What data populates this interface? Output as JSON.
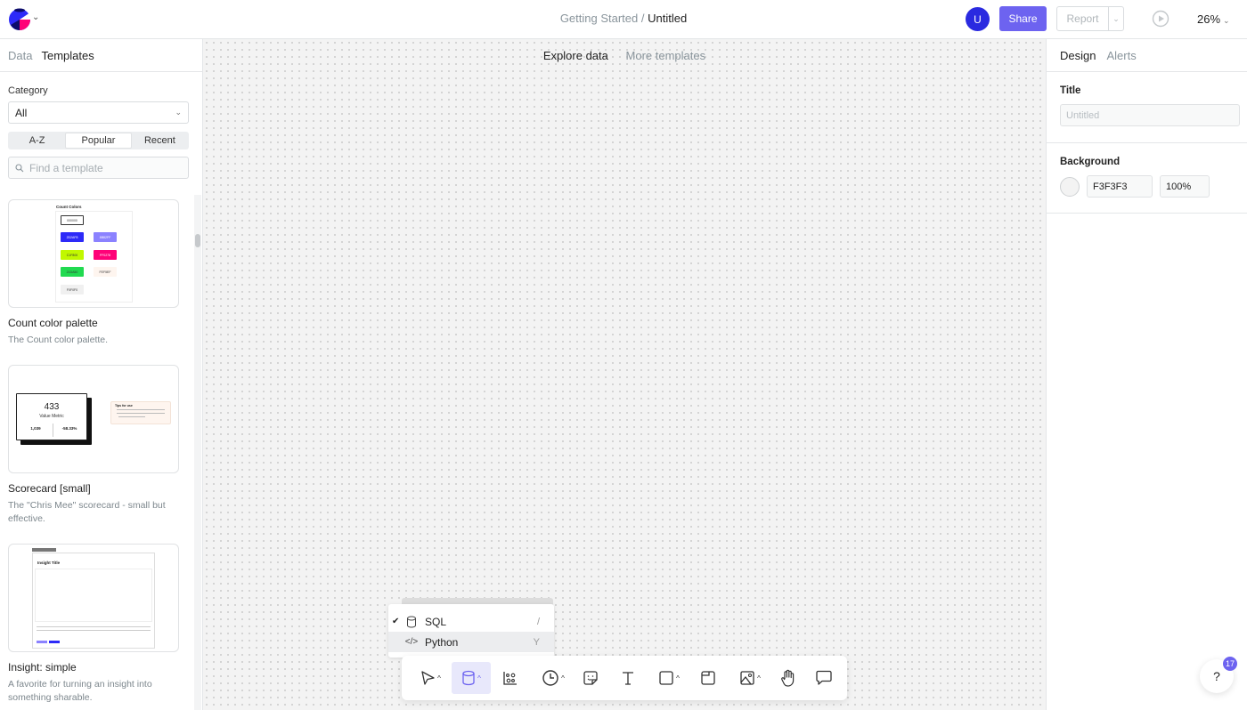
{
  "header": {
    "breadcrumb_parent": "Getting Started",
    "breadcrumb_sep": " / ",
    "breadcrumb_current": "Untitled",
    "avatar_initial": "U",
    "share_label": "Share",
    "report_label": "Report",
    "zoom_level": "26%"
  },
  "left_panel": {
    "tabs": [
      {
        "label": "Data",
        "active": false
      },
      {
        "label": "Templates",
        "active": true
      }
    ],
    "category_label": "Category",
    "category_value": "All",
    "sort_options": [
      {
        "label": "A-Z",
        "active": false
      },
      {
        "label": "Popular",
        "active": true
      },
      {
        "label": "Recent",
        "active": false
      }
    ],
    "search_placeholder": "Find a template",
    "templates": [
      {
        "title": "Count color palette",
        "description": "The Count color palette.",
        "preview": {
          "heading": "Count Colors",
          "swatches": [
            {
              "label": "000000",
              "color": "#ffffff",
              "text": "#333333"
            },
            {
              "label": "2D2AF8",
              "color": "#2d2af8",
              "text": "#ffffff"
            },
            {
              "label": "8B82FF",
              "color": "#8b82ff",
              "text": "#ffffff"
            },
            {
              "label": "C1F800",
              "color": "#c1f800",
              "text": "#333333"
            },
            {
              "label": "FF0278",
              "color": "#ff0278",
              "text": "#ffffff"
            },
            {
              "label": "21DA50",
              "color": "#21da50",
              "text": "#333333"
            },
            {
              "label": "FEF5EF",
              "color": "#fef5ef",
              "text": "#333333"
            },
            {
              "label": "F0F0F0",
              "color": "#f0f0f0",
              "text": "#333333"
            }
          ]
        }
      },
      {
        "title": "Scorecard [small]",
        "description": "The \"Chris Mee\" scorecard - small but effective.",
        "preview": {
          "value": "433",
          "metric": "Value Metric",
          "left_value": "1,039",
          "right_value": "-58.33%",
          "tips_title": "Tips for use"
        }
      },
      {
        "title": "Insight: simple",
        "description": "A favorite for turning an insight into something sharable.",
        "preview": {
          "heading": "Insight Title"
        }
      }
    ]
  },
  "canvas": {
    "tabs": [
      {
        "label": "Explore data",
        "active": true
      },
      {
        "label": "More templates",
        "active": false
      }
    ],
    "background": "#f3f3f3"
  },
  "cell_type_menu": {
    "items": [
      {
        "label": "SQL",
        "shortcut": "/",
        "checked": true,
        "icon": "database-icon"
      },
      {
        "label": "Python",
        "shortcut": "Y",
        "checked": false,
        "icon": "code-icon",
        "hovered": true
      }
    ]
  },
  "toolbar": {
    "tools": [
      {
        "name": "select",
        "icon": "cursor-icon",
        "has_menu": true
      },
      {
        "name": "data-cell",
        "icon": "database-icon",
        "has_menu": true,
        "active": true
      },
      {
        "name": "visual",
        "icon": "scatter-chart-icon",
        "has_menu": false
      },
      {
        "name": "history",
        "icon": "clock-icon",
        "has_menu": true
      },
      {
        "name": "sticky",
        "icon": "sticky-note-icon",
        "has_menu": false
      },
      {
        "name": "text",
        "icon": "text-icon",
        "has_menu": false
      },
      {
        "name": "shape",
        "icon": "square-icon",
        "has_menu": true
      },
      {
        "name": "frame",
        "icon": "frame-icon",
        "has_menu": false
      },
      {
        "name": "image",
        "icon": "image-icon",
        "has_menu": true
      },
      {
        "name": "hand",
        "icon": "hand-icon",
        "has_menu": false
      },
      {
        "name": "comment",
        "icon": "comment-icon",
        "has_menu": false
      }
    ]
  },
  "right_panel": {
    "tabs": [
      {
        "label": "Design",
        "active": true
      },
      {
        "label": "Alerts",
        "active": false
      }
    ],
    "title_label": "Title",
    "title_placeholder": "Untitled",
    "background_label": "Background",
    "background_hex": "F3F3F3",
    "background_opacity": "100%"
  },
  "help": {
    "label": "?",
    "badge_count": "17"
  },
  "colors": {
    "accent": "#6d63f0",
    "avatar": "#2a2ae0",
    "tool_active_bg": "#e8e8fb"
  }
}
